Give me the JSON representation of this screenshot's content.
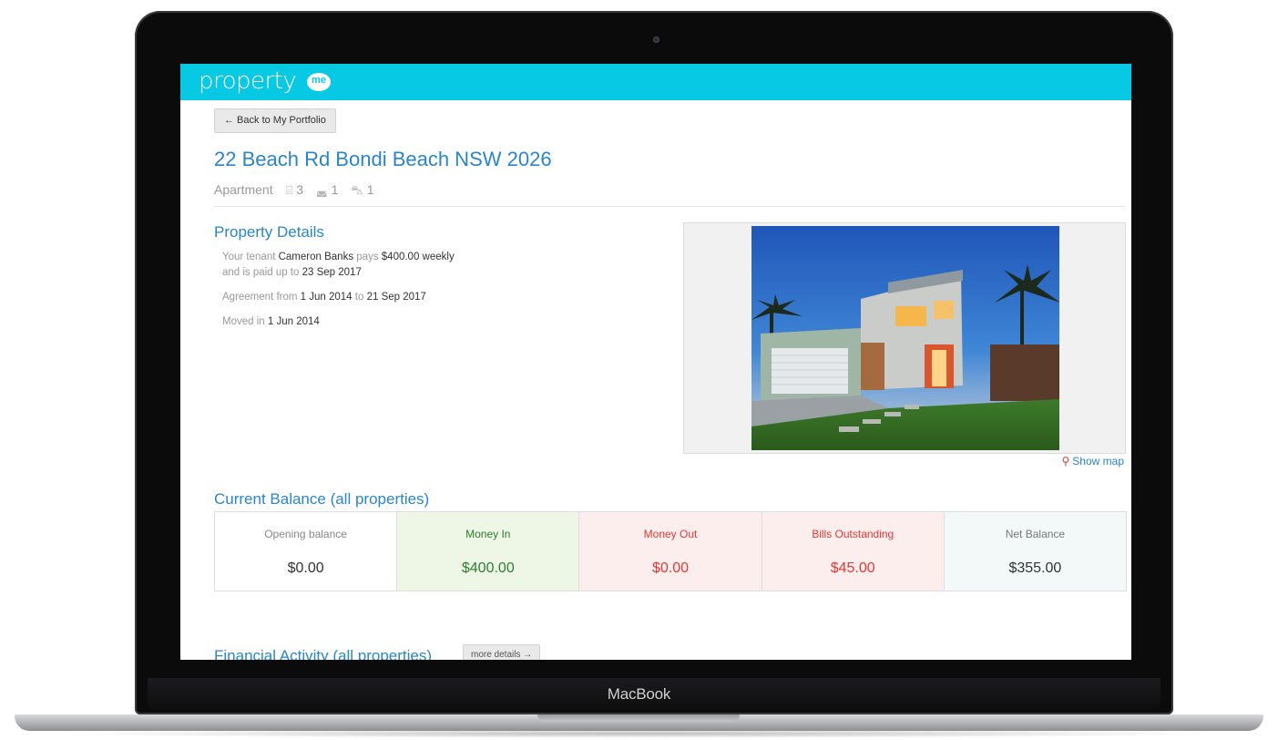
{
  "device": {
    "brand_label": "MacBook"
  },
  "app": {
    "logo": {
      "text": "property",
      "badge": "me"
    },
    "back_button": "← Back to My Portfolio",
    "address": "22 Beach Rd Bondi Beach NSW 2026",
    "property_type": "Apartment",
    "features": [
      {
        "icon": "bed-icon",
        "value": "3"
      },
      {
        "icon": "bath-icon",
        "value": "1"
      },
      {
        "icon": "car-icon",
        "value": "1"
      }
    ],
    "property_details": {
      "heading": "Property Details",
      "tenant_prefix": "Your tenant",
      "tenant_name": "Cameron Banks",
      "pays_word": "pays",
      "rent": "$400.00 weekly",
      "paid_prefix": "and is paid up to",
      "paid_date": "23 Sep 2017",
      "agreement_prefix": "Agreement from",
      "agreement_start": "1 Jun 2014",
      "agreement_to": "to",
      "agreement_end": "21 Sep 2017",
      "moved_prefix": "Moved in",
      "moved_date": "1 Jun 2014"
    },
    "show_map": "Show map",
    "current_balance": {
      "heading": "Current Balance (all properties)",
      "cells": [
        {
          "label": "Opening balance",
          "value": "$0.00",
          "label_color": "#888888",
          "value_color": "#333333",
          "bg": "#ffffff"
        },
        {
          "label": "Money In",
          "value": "$400.00",
          "label_color": "#2e7d32",
          "value_color": "#2e7d32",
          "bg": "#eef6e6"
        },
        {
          "label": "Money Out",
          "value": "$0.00",
          "label_color": "#e53935",
          "value_color": "#e53935",
          "bg": "#fdeeee"
        },
        {
          "label": "Bills Outstanding",
          "value": "$45.00",
          "label_color": "#e53935",
          "value_color": "#e53935",
          "bg": "#fdeeee"
        },
        {
          "label": "Net Balance",
          "value": "$355.00",
          "label_color": "#777777",
          "value_color": "#333333",
          "bg": "#f3f9f9"
        }
      ]
    },
    "financial_activity": {
      "heading": "Financial Activity (all properties)",
      "more_button": "more details →"
    }
  },
  "colors": {
    "accent": "#08c9e3",
    "link": "#2a86c9"
  }
}
